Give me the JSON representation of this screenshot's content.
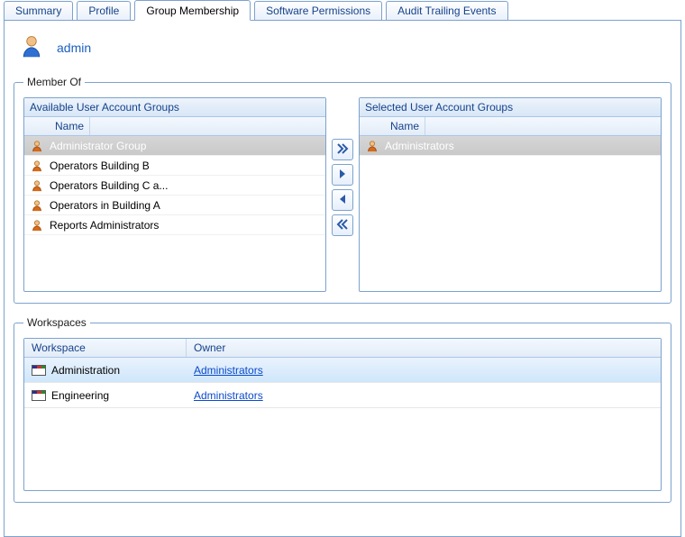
{
  "tabs": {
    "items": [
      {
        "label": "Summary"
      },
      {
        "label": "Profile"
      },
      {
        "label": "Group Membership"
      },
      {
        "label": "Software Permissions"
      },
      {
        "label": "Audit Trailing Events"
      }
    ],
    "active_index": 2
  },
  "user": {
    "name": "admin"
  },
  "member_of": {
    "legend": "Member Of",
    "available": {
      "title": "Available User Account Groups",
      "header": "Name",
      "items": [
        {
          "label": "Administrator Group",
          "selected": true
        },
        {
          "label": "Operators Building B"
        },
        {
          "label": "Operators Building C a..."
        },
        {
          "label": "Operators in Building A"
        },
        {
          "label": "Reports Administrators"
        }
      ]
    },
    "selected": {
      "title": "Selected User Account Groups",
      "header": "Name",
      "items": [
        {
          "label": "Administrators",
          "selected": true
        }
      ]
    },
    "buttons": {
      "move_all_right": "move-all-right",
      "move_right": "move-right",
      "move_left": "move-left",
      "move_all_left": "move-all-left"
    }
  },
  "workspaces": {
    "legend": "Workspaces",
    "columns": {
      "c1": "Workspace",
      "c2": "Owner"
    },
    "rows": [
      {
        "name": "Administration",
        "owner": "Administrators",
        "selected": true
      },
      {
        "name": "Engineering",
        "owner": "Administrators"
      }
    ]
  },
  "colors": {
    "accent": "#7da2ce",
    "link": "#0b4acb"
  }
}
